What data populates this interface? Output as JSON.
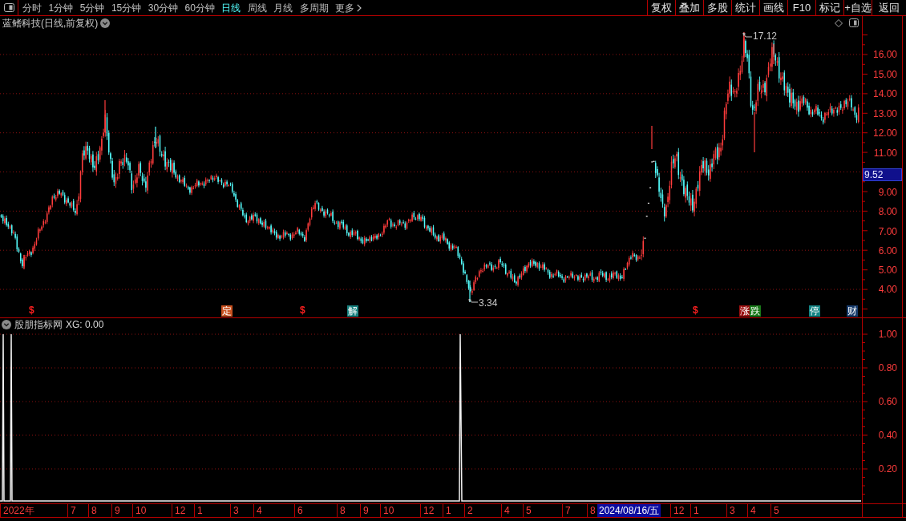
{
  "toolbar": {
    "periods": [
      {
        "label": "分时",
        "kind": "period",
        "selected": false
      },
      {
        "label": "1分钟",
        "kind": "period",
        "selected": false
      },
      {
        "label": "5分钟",
        "kind": "period",
        "selected": false
      },
      {
        "label": "15分钟",
        "kind": "period",
        "selected": false
      },
      {
        "label": "30分钟",
        "kind": "period",
        "selected": false
      },
      {
        "label": "60分钟",
        "kind": "period",
        "selected": false
      },
      {
        "label": "日线",
        "kind": "period",
        "selected": true
      },
      {
        "label": "周线",
        "kind": "period",
        "selected": false
      },
      {
        "label": "月线",
        "kind": "period",
        "selected": false
      },
      {
        "label": "多周期",
        "kind": "period",
        "selected": false
      },
      {
        "label": "更多",
        "kind": "menu",
        "selected": false
      }
    ],
    "buttons": [
      "复权",
      "叠加",
      "多股",
      "统计",
      "画线",
      "F10",
      "标记",
      "+自选",
      "返回"
    ]
  },
  "chart_title": "蓝鳍科技(日线,前复权)",
  "price_panel": {
    "axis_labels": [
      "16.00",
      "15.00",
      "14.00",
      "13.00",
      "12.00",
      "11.00",
      "9.00",
      "8.00",
      "7.00",
      "6.00",
      "5.00",
      "4.00"
    ],
    "current_price": "9.52",
    "high_label": "17.12",
    "low_label": "3.34",
    "markers": [
      {
        "text": "$",
        "kind": "signal",
        "color": "#ff2020"
      },
      {
        "text": "定",
        "kind": "tag",
        "color": "#c8501e"
      },
      {
        "text": "$",
        "kind": "signal",
        "color": "#ff2020"
      },
      {
        "text": "解",
        "kind": "tag",
        "color": "#16807e"
      },
      {
        "text": "$",
        "kind": "signal",
        "color": "#ff2020"
      },
      {
        "text": "涨",
        "kind": "tag",
        "color": "#9c1010"
      },
      {
        "text": "跌",
        "kind": "tag",
        "color": "#187818"
      },
      {
        "text": "停",
        "kind": "tag",
        "color": "#148484"
      },
      {
        "text": "财",
        "kind": "tag",
        "color": "#183c6c"
      }
    ]
  },
  "indicator_panel": {
    "name": "股朋指标网",
    "reading": "XG: 0.00",
    "axis_labels": [
      "1.00",
      "0.80",
      "0.60",
      "0.40",
      "0.20"
    ]
  },
  "date_axis": {
    "labels": [
      {
        "text": "2022年",
        "kind": "tick"
      },
      {
        "text": "7",
        "kind": "tick"
      },
      {
        "text": "8",
        "kind": "tick"
      },
      {
        "text": "9",
        "kind": "tick"
      },
      {
        "text": "10",
        "kind": "tick"
      },
      {
        "text": "12",
        "kind": "tick"
      },
      {
        "text": "1",
        "kind": "tick"
      },
      {
        "text": "3",
        "kind": "tick"
      },
      {
        "text": "4",
        "kind": "tick"
      },
      {
        "text": "6",
        "kind": "tick"
      },
      {
        "text": "8",
        "kind": "tick"
      },
      {
        "text": "9",
        "kind": "tick"
      },
      {
        "text": "10",
        "kind": "tick"
      },
      {
        "text": "12",
        "kind": "tick"
      },
      {
        "text": "1",
        "kind": "tick"
      },
      {
        "text": "2",
        "kind": "tick"
      },
      {
        "text": "4",
        "kind": "tick"
      },
      {
        "text": "5",
        "kind": "tick"
      },
      {
        "text": "7",
        "kind": "tick"
      },
      {
        "text": "8",
        "kind": "tick"
      },
      {
        "text": "2024/08/16/五",
        "kind": "cursor"
      },
      {
        "text": "12",
        "kind": "tick"
      },
      {
        "text": "1",
        "kind": "tick"
      },
      {
        "text": "3",
        "kind": "tick"
      },
      {
        "text": "4",
        "kind": "tick"
      },
      {
        "text": "5",
        "kind": "tick"
      }
    ]
  }
}
